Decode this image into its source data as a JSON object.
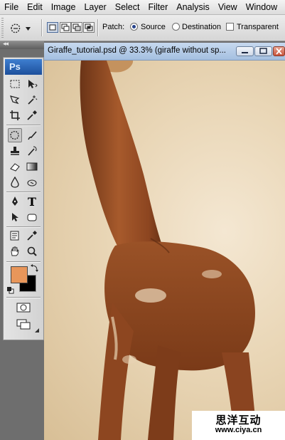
{
  "menubar": {
    "items": [
      "File",
      "Edit",
      "Image",
      "Layer",
      "Select",
      "Filter",
      "Analysis",
      "View",
      "Window"
    ]
  },
  "options_bar": {
    "tool_preset_icon": "patch-tool-icon",
    "patch_label": "Patch:",
    "source_label": "Source",
    "source_checked": true,
    "destination_label": "Destination",
    "destination_checked": false,
    "transparent_label": "Transparent",
    "transparent_checked": false,
    "selection_modes": [
      "new-selection",
      "add-to-selection",
      "subtract-from-selection",
      "intersect-with-selection"
    ],
    "active_mode": "new-selection"
  },
  "toolbox": {
    "logo": "Ps",
    "collapse_glyph": "◂◂",
    "tools": [
      "rectangular-marquee-tool",
      "move-tool",
      "lasso-tool",
      "magic-wand-tool",
      "crop-tool",
      "eyedropper-slice-tool",
      "patch-tool",
      "brush-tool",
      "clone-stamp-tool",
      "history-brush-tool",
      "eraser-tool",
      "gradient-tool",
      "blur-tool",
      "dodge-tool",
      "pen-tool",
      "type-tool",
      "path-selection-tool",
      "shape-tool",
      "notes-tool",
      "eyedropper-tool",
      "hand-tool",
      "zoom-tool"
    ],
    "selected_tool": "patch-tool",
    "type_tool_glyph": "T",
    "foreground_color": "#e8965a",
    "background_color": "#000000"
  },
  "document": {
    "title": "Giraffe_tutorial.psd @ 33.3% (giraffe without sp...",
    "zoom": "33.3%"
  },
  "watermark": {
    "cn": "思洋互动",
    "url": "www.ciya.cn"
  }
}
